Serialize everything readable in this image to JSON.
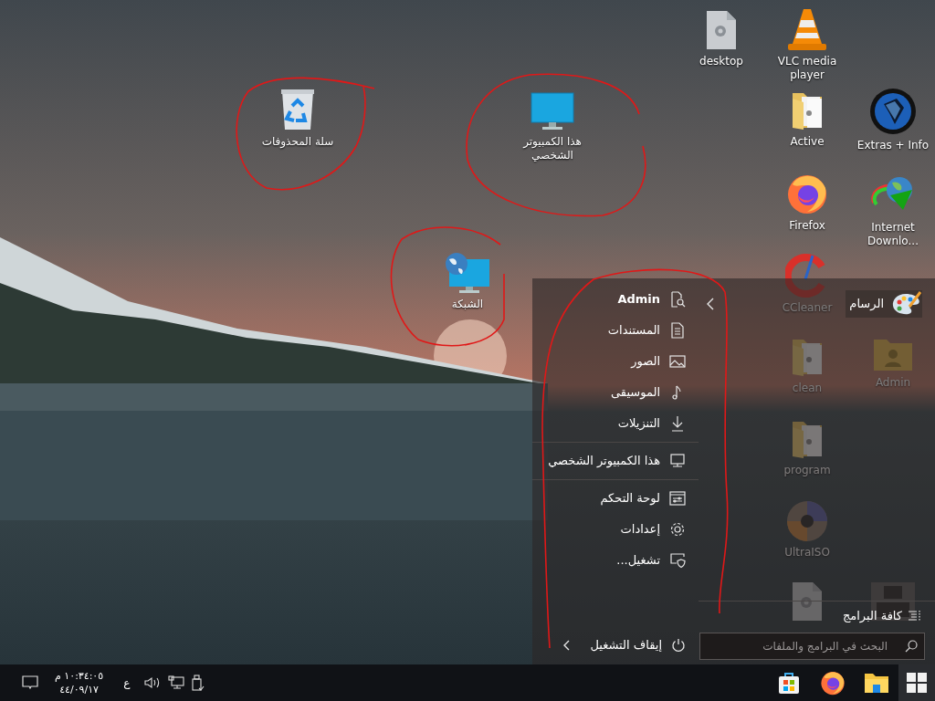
{
  "system_icons": [
    {
      "label": "هذا الكمبيوتر الشخصي",
      "kind": "pc"
    },
    {
      "label": "سلة المحذوفات",
      "kind": "recycle-bin"
    },
    {
      "label": "الشبكة",
      "kind": "network"
    }
  ],
  "desktop_icons": [
    {
      "label": "desktop",
      "kind": "settings-file"
    },
    {
      "label": "VLC media player",
      "kind": "vlc"
    },
    {
      "label": "Active",
      "kind": "folder"
    },
    {
      "label": "Extras + Info",
      "kind": "extras"
    },
    {
      "label": "Firefox",
      "kind": "firefox"
    },
    {
      "label": "Internet Downlo...",
      "kind": "idm"
    },
    {
      "label": "CCleaner",
      "kind": "ccleaner"
    },
    {
      "label": "clean",
      "kind": "folder"
    },
    {
      "label": "Admin",
      "kind": "user-folder"
    },
    {
      "label": "program",
      "kind": "folder"
    },
    {
      "label": "UltraISO",
      "kind": "disc"
    },
    {
      "kind": "settings-file"
    },
    {
      "kind": "archive"
    }
  ],
  "start_menu": {
    "place_groups": [
      [
        {
          "label": "Admin",
          "kind": "user"
        },
        {
          "label": "المستندات",
          "kind": "documents"
        },
        {
          "label": "الصور",
          "kind": "pictures"
        },
        {
          "label": "الموسيقى",
          "kind": "music"
        },
        {
          "label": "التنزيلات",
          "kind": "downloads"
        }
      ],
      [
        {
          "label": "هذا الكمبيوتر الشخصي",
          "kind": "pc"
        }
      ],
      [
        {
          "label": "لوحة التحكم",
          "kind": "control-panel"
        },
        {
          "label": "إعدادات",
          "kind": "settings"
        },
        {
          "label": "تشغيل...",
          "kind": "run"
        }
      ]
    ],
    "pinned_apps": [
      {
        "label": "الرسام",
        "kind": "paint",
        "has_submenu": true
      }
    ],
    "all_programs": "كافة البرامج",
    "search": {
      "placeholder": "البحث في البرامج والملفات"
    },
    "power": {
      "label": "إيقاف التشغيل"
    }
  },
  "taskbar": {
    "clock": {
      "time": "١٠:٣٤:٠٥ م",
      "date": "٤٤/٠٩/١٧"
    },
    "language": "ع",
    "pinned": [
      {
        "kind": "store"
      },
      {
        "kind": "firefox"
      },
      {
        "kind": "explorer"
      }
    ]
  }
}
